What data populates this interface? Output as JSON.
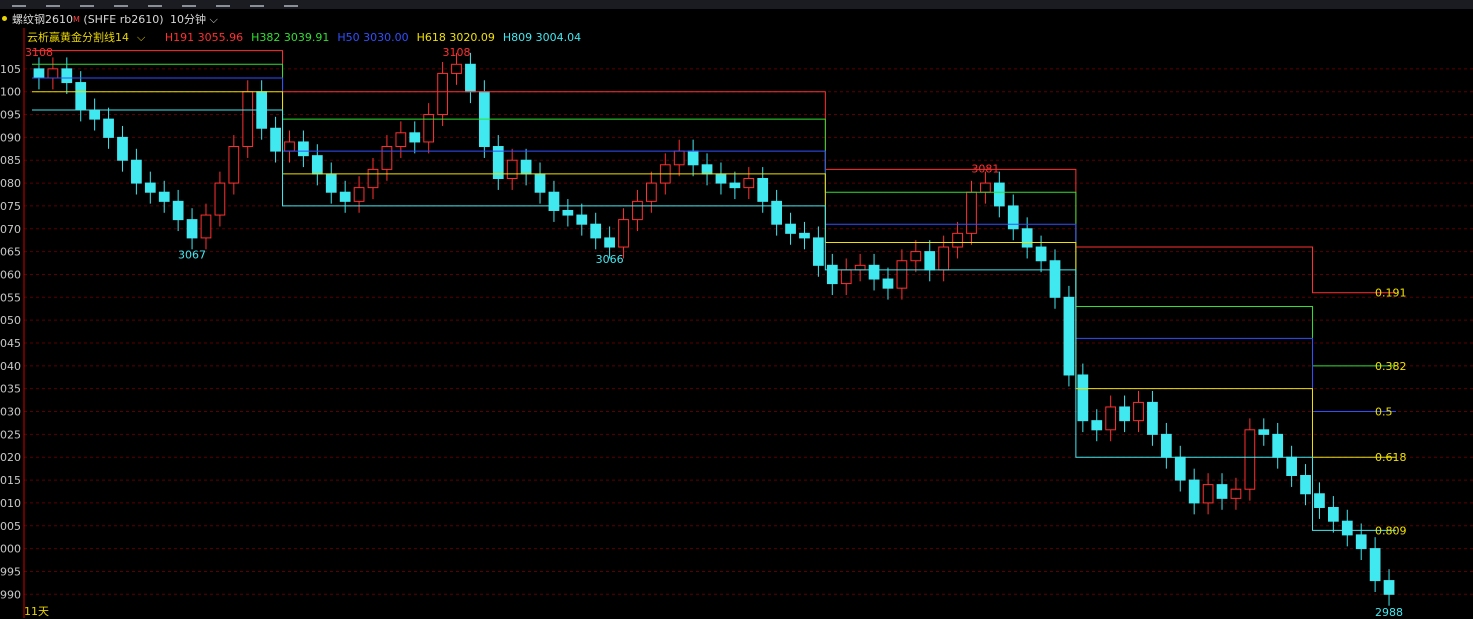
{
  "toolbar": {
    "icons": [
      "menu-icon",
      "bars-icon",
      "draw-icon",
      "chart-icon",
      "line-icon",
      "indicator-icon",
      "grid-icon",
      "list-icon",
      "settings-icon"
    ]
  },
  "title": {
    "name": "螺纹钢2610",
    "superscript": "M",
    "code": "(SHFE rb2610)",
    "period": "10分钟",
    "period_icon": "chevron-down-icon"
  },
  "indicator": {
    "name": "云析赢黄金分割线14",
    "dropdown_icon": "chevron-down-icon",
    "values": [
      {
        "label": "H191",
        "value": "3055.96",
        "color": "#ff3030"
      },
      {
        "label": "H382",
        "value": "3039.91",
        "color": "#30e030"
      },
      {
        "label": "H50",
        "value": "3030.00",
        "color": "#3050ff"
      },
      {
        "label": "H618",
        "value": "3020.09",
        "color": "#f0e000"
      },
      {
        "label": "H809",
        "value": "3004.04",
        "color": "#40e8f0"
      }
    ]
  },
  "footer": {
    "days_label": "11天"
  },
  "colors": {
    "up": "#ff3030",
    "down": "#40e8f0",
    "grid": "#5a0000",
    "axis": "#d00000"
  },
  "chart_data": {
    "type": "candlestick",
    "ylim": [
      2987,
      3110
    ],
    "y_ticks": [
      2990,
      2995,
      3000,
      3005,
      3010,
      3015,
      3020,
      3025,
      3030,
      3035,
      3040,
      3045,
      3050,
      3055,
      3060,
      3065,
      3070,
      3075,
      3080,
      3085,
      3090,
      3095,
      3100,
      3105
    ],
    "grid": true,
    "close_series": [
      3103,
      3105,
      3102,
      3096,
      3094,
      3090,
      3085,
      3080,
      3078,
      3076,
      3072,
      3068,
      3073,
      3080,
      3088,
      3100,
      3092,
      3087,
      3089,
      3086,
      3082,
      3078,
      3076,
      3079,
      3083,
      3088,
      3091,
      3089,
      3095,
      3104,
      3106,
      3100,
      3088,
      3081,
      3085,
      3082,
      3078,
      3074,
      3073,
      3071,
      3068,
      3066,
      3072,
      3076,
      3080,
      3084,
      3087,
      3084,
      3082,
      3080,
      3079,
      3081,
      3076,
      3071,
      3069,
      3068,
      3062,
      3058,
      3061,
      3062,
      3059,
      3057,
      3063,
      3065,
      3061,
      3066,
      3069,
      3078,
      3080,
      3075,
      3070,
      3066,
      3063,
      3055,
      3038,
      3028,
      3026,
      3031,
      3028,
      3032,
      3025,
      3020,
      3015,
      3010,
      3014,
      3011,
      3013,
      3026,
      3025,
      3020,
      3016,
      3012,
      3009,
      3006,
      3003,
      3000,
      2993,
      2990
    ],
    "swing_labels": [
      {
        "text": "3108",
        "type": "high",
        "index": 0
      },
      {
        "text": "3108",
        "type": "high",
        "index": 30
      },
      {
        "text": "3067",
        "type": "low",
        "index": 11
      },
      {
        "text": "3066",
        "type": "low",
        "index": 41
      },
      {
        "text": "3081",
        "type": "high",
        "index": 68
      },
      {
        "text": "2988",
        "type": "low",
        "index": 97
      }
    ],
    "fib_series": [
      {
        "name": "0.191",
        "color": "#ff3030",
        "levels": [
          {
            "from": 0,
            "value": 3109
          },
          {
            "from": 18,
            "value": 3100
          },
          {
            "from": 57,
            "value": 3083
          },
          {
            "from": 75,
            "value": 3066
          },
          {
            "from": 92,
            "value": 3056
          }
        ]
      },
      {
        "name": "0.382",
        "color": "#30e030",
        "levels": [
          {
            "from": 0,
            "value": 3106
          },
          {
            "from": 18,
            "value": 3094
          },
          {
            "from": 57,
            "value": 3078
          },
          {
            "from": 75,
            "value": 3053
          },
          {
            "from": 92,
            "value": 3040
          }
        ]
      },
      {
        "name": "0.5",
        "color": "#3050ff",
        "levels": [
          {
            "from": 0,
            "value": 3103
          },
          {
            "from": 18,
            "value": 3087
          },
          {
            "from": 57,
            "value": 3071
          },
          {
            "from": 75,
            "value": 3046
          },
          {
            "from": 92,
            "value": 3030
          }
        ]
      },
      {
        "name": "0.618",
        "color": "#f0e000",
        "levels": [
          {
            "from": 0,
            "value": 3100
          },
          {
            "from": 18,
            "value": 3082
          },
          {
            "from": 57,
            "value": 3067
          },
          {
            "from": 75,
            "value": 3035
          },
          {
            "from": 92,
            "value": 3020
          }
        ]
      },
      {
        "name": "0.809",
        "color": "#40e8f0",
        "levels": [
          {
            "from": 0,
            "value": 3096
          },
          {
            "from": 18,
            "value": 3075
          },
          {
            "from": 57,
            "value": 3061
          },
          {
            "from": 75,
            "value": 3020
          },
          {
            "from": 92,
            "value": 3004
          }
        ]
      }
    ]
  }
}
